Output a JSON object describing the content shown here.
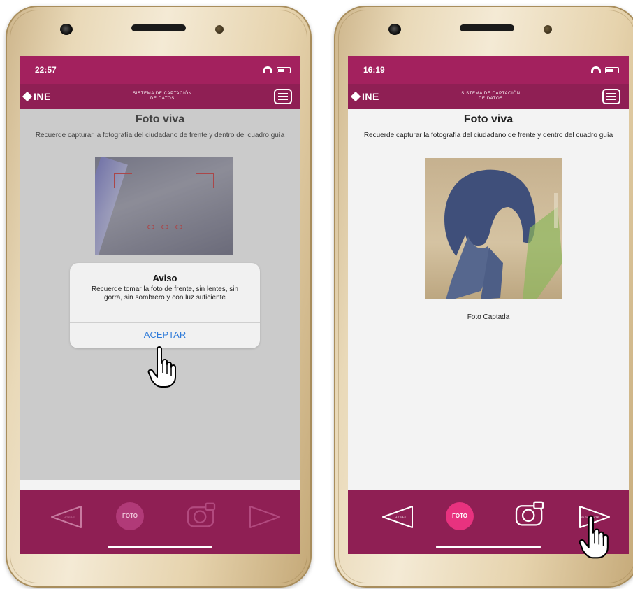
{
  "left_phone": {
    "time": "22:57",
    "app_title": "SISTEMA DE CAPTACIÓN DE DATOS",
    "logo_text": "INE",
    "page_title": "Foto viva",
    "instruction": "Recuerde capturar la fotografía del ciudadano de frente y dentro del cuadro guía",
    "dialog": {
      "title": "Aviso",
      "message": "Recuerde tomar la foto de frente, sin lentes, sin gorra, sin sombrero y con luz suficiente",
      "button": "ACEPTAR"
    },
    "nav": {
      "prev_label": "atrás",
      "foto_label": "FOTO"
    }
  },
  "right_phone": {
    "time": "16:19",
    "app_title": "SISTEMA DE CAPTACIÓN DE DATOS",
    "logo_text": "INE",
    "page_title": "Foto viva",
    "instruction": "Recuerde capturar la fotografía del ciudadano de frente y dentro del cuadro guía",
    "photo_caption": "Foto Captada",
    "nav": {
      "prev_label": "atrás",
      "foto_label": "FOTO",
      "next_label": "siguiente"
    }
  },
  "colors": {
    "status_bar": "#a3215e",
    "app_bar": "#8f1f54",
    "bottom_bar": "#8f1f54",
    "foto_button": "#e8327f",
    "dialog_accept": "#2f7bd9"
  },
  "icons": [
    "menu-icon",
    "back-arrow-icon",
    "camera-icon",
    "forward-arrow-icon",
    "hand-pointer-icon",
    "wifi-icon",
    "battery-icon"
  ]
}
